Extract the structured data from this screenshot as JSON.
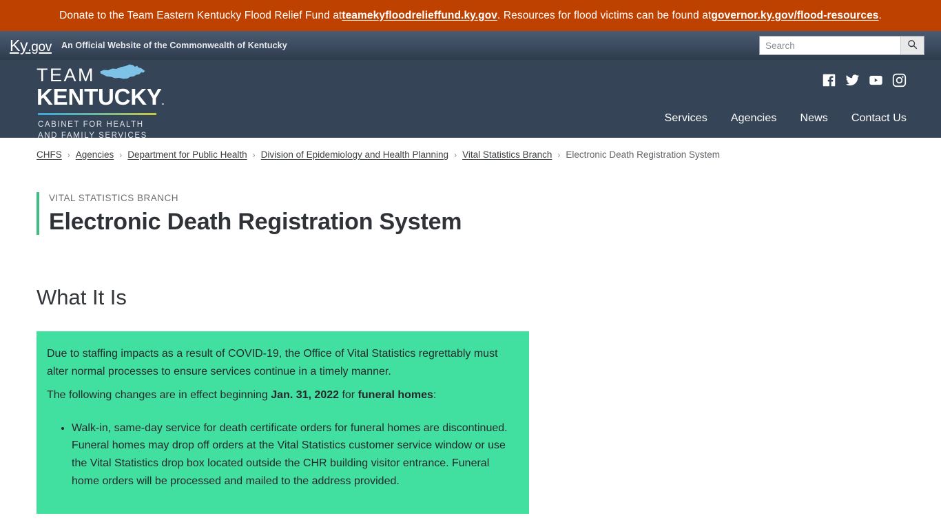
{
  "alert": {
    "text_before": "Donate to the Team Eastern Kentucky Flood Relief Fund at ",
    "link1": "teamekyfloodrelieffund.ky.gov",
    "text_middle": ". Resources for flood victims can be found at ",
    "link2": "governor.ky.gov/flood-resources",
    "text_after": ".",
    "background_color": "#bf4100"
  },
  "kygov": {
    "logo_main": "Ky",
    "logo_suffix": ".gov",
    "tagline": "An Official Website of the Commonwealth of Kentucky",
    "search": {
      "placeholder": "Search",
      "value": "",
      "button_icon": "search-icon"
    }
  },
  "masthead": {
    "logo": {
      "line1": "TEAM",
      "line2": "KENTUCKY",
      "registered": ".",
      "sub_line1": "CABINET FOR HEALTH",
      "sub_line2": "AND FAMILY SERVICES",
      "shape": "kentucky-state-icon"
    },
    "social": [
      {
        "name": "facebook-icon",
        "label": "Facebook"
      },
      {
        "name": "twitter-icon",
        "label": "Twitter"
      },
      {
        "name": "youtube-icon",
        "label": "YouTube"
      },
      {
        "name": "instagram-icon",
        "label": "Instagram"
      }
    ],
    "nav": [
      {
        "label": "Services"
      },
      {
        "label": "Agencies"
      },
      {
        "label": "News"
      },
      {
        "label": "Contact Us"
      }
    ],
    "background_color": "#364457"
  },
  "breadcrumb": {
    "separator": "›",
    "items": [
      {
        "label": "CHFS",
        "link": true
      },
      {
        "label": "Agencies",
        "link": true
      },
      {
        "label": "Department for Public Health",
        "link": true
      },
      {
        "label": "Division of Epidemiology and Health Planning",
        "link": true
      },
      {
        "label": "Vital Statistics Branch",
        "link": true
      },
      {
        "label": "Electronic Death Registration System",
        "link": false
      }
    ]
  },
  "page": {
    "eyebrow": "VITAL STATISTICS BRANCH",
    "title": "Electronic Death Registration System",
    "accent_color": "#3cbd82"
  },
  "main": {
    "section_heading": "What It Is",
    "callout": {
      "background_color": "#41e0a1",
      "paragraph1": "Due to staffing impacts as a result of COVID-19, the Office of Vital Statistics regrettably must alter normal processes to ensure services continue in a timely manner.",
      "paragraph2_before": "The following changes are in effect beginning ",
      "paragraph2_date": "Jan. 31, 2022",
      "paragraph2_middle": " for ",
      "paragraph2_bold": "funeral homes",
      "paragraph2_after": ":",
      "bullets": [
        "Walk-in, same-day service for death certificate orders for funeral homes are discontinued. Funeral homes may drop off orders at the Vital Statistics customer service window or use the Vital Statistics drop box located outside the CHR building visitor entrance. Funeral home orders will be processed and mailed to the address provided."
      ]
    }
  }
}
